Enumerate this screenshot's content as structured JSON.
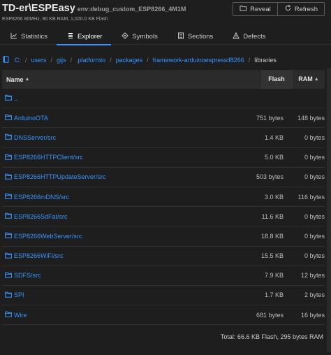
{
  "header": {
    "title": "TD-er\\ESPEasy",
    "env": "env:debug_custom_ESP8266_4M1M",
    "subtitle": "ESP8266 80MHz, 80 KB RAM, 1,020.0 KB Flash",
    "reveal_label": "Reveal",
    "refresh_label": "Refresh"
  },
  "tabs": [
    {
      "label": "Statistics",
      "icon": "statistics-icon",
      "active": false
    },
    {
      "label": "Explorer",
      "icon": "explorer-icon",
      "active": true
    },
    {
      "label": "Symbols",
      "icon": "symbols-icon",
      "active": false
    },
    {
      "label": "Sections",
      "icon": "sections-icon",
      "active": false
    },
    {
      "label": "Defects",
      "icon": "defects-icon",
      "active": false
    }
  ],
  "breadcrumb": {
    "icon": "database-icon",
    "links": [
      "C:",
      "users",
      "gijs",
      ".platformio",
      "packages",
      "framework-arduinoespressif8266"
    ],
    "current": "libraries"
  },
  "table": {
    "headers": {
      "name": "Name",
      "flash": "Flash",
      "ram": "RAM"
    },
    "rows": [
      {
        "name": "..",
        "flash": "",
        "ram": ""
      },
      {
        "name": "ArduinoOTA",
        "flash": "751 bytes",
        "ram": "148 bytes"
      },
      {
        "name": "DNSServer/src",
        "flash": "1.4 KB",
        "ram": "0 bytes"
      },
      {
        "name": "ESP8266HTTPClient/src",
        "flash": "5.0 KB",
        "ram": "0 bytes"
      },
      {
        "name": "ESP8266HTTPUpdateServer/src",
        "flash": "503 bytes",
        "ram": "0 bytes"
      },
      {
        "name": "ESP8266mDNS/src",
        "flash": "3.0 KB",
        "ram": "116 bytes"
      },
      {
        "name": "ESP8266SdFat/src",
        "flash": "11.6 KB",
        "ram": "0 bytes"
      },
      {
        "name": "ESP8266WebServer/src",
        "flash": "18.8 KB",
        "ram": "0 bytes"
      },
      {
        "name": "ESP8266WiFi/src",
        "flash": "15.5 KB",
        "ram": "0 bytes"
      },
      {
        "name": "SDFS/src",
        "flash": "7.9 KB",
        "ram": "12 bytes"
      },
      {
        "name": "SPI",
        "flash": "1.7 KB",
        "ram": "2 bytes"
      },
      {
        "name": "Wire",
        "flash": "681 bytes",
        "ram": "16 bytes"
      }
    ],
    "total": "Total: 66.6 KB Flash, 295 bytes RAM"
  },
  "colors": {
    "background": "#1e1e1e",
    "link": "#3794ff",
    "accent": "#3794ff"
  }
}
